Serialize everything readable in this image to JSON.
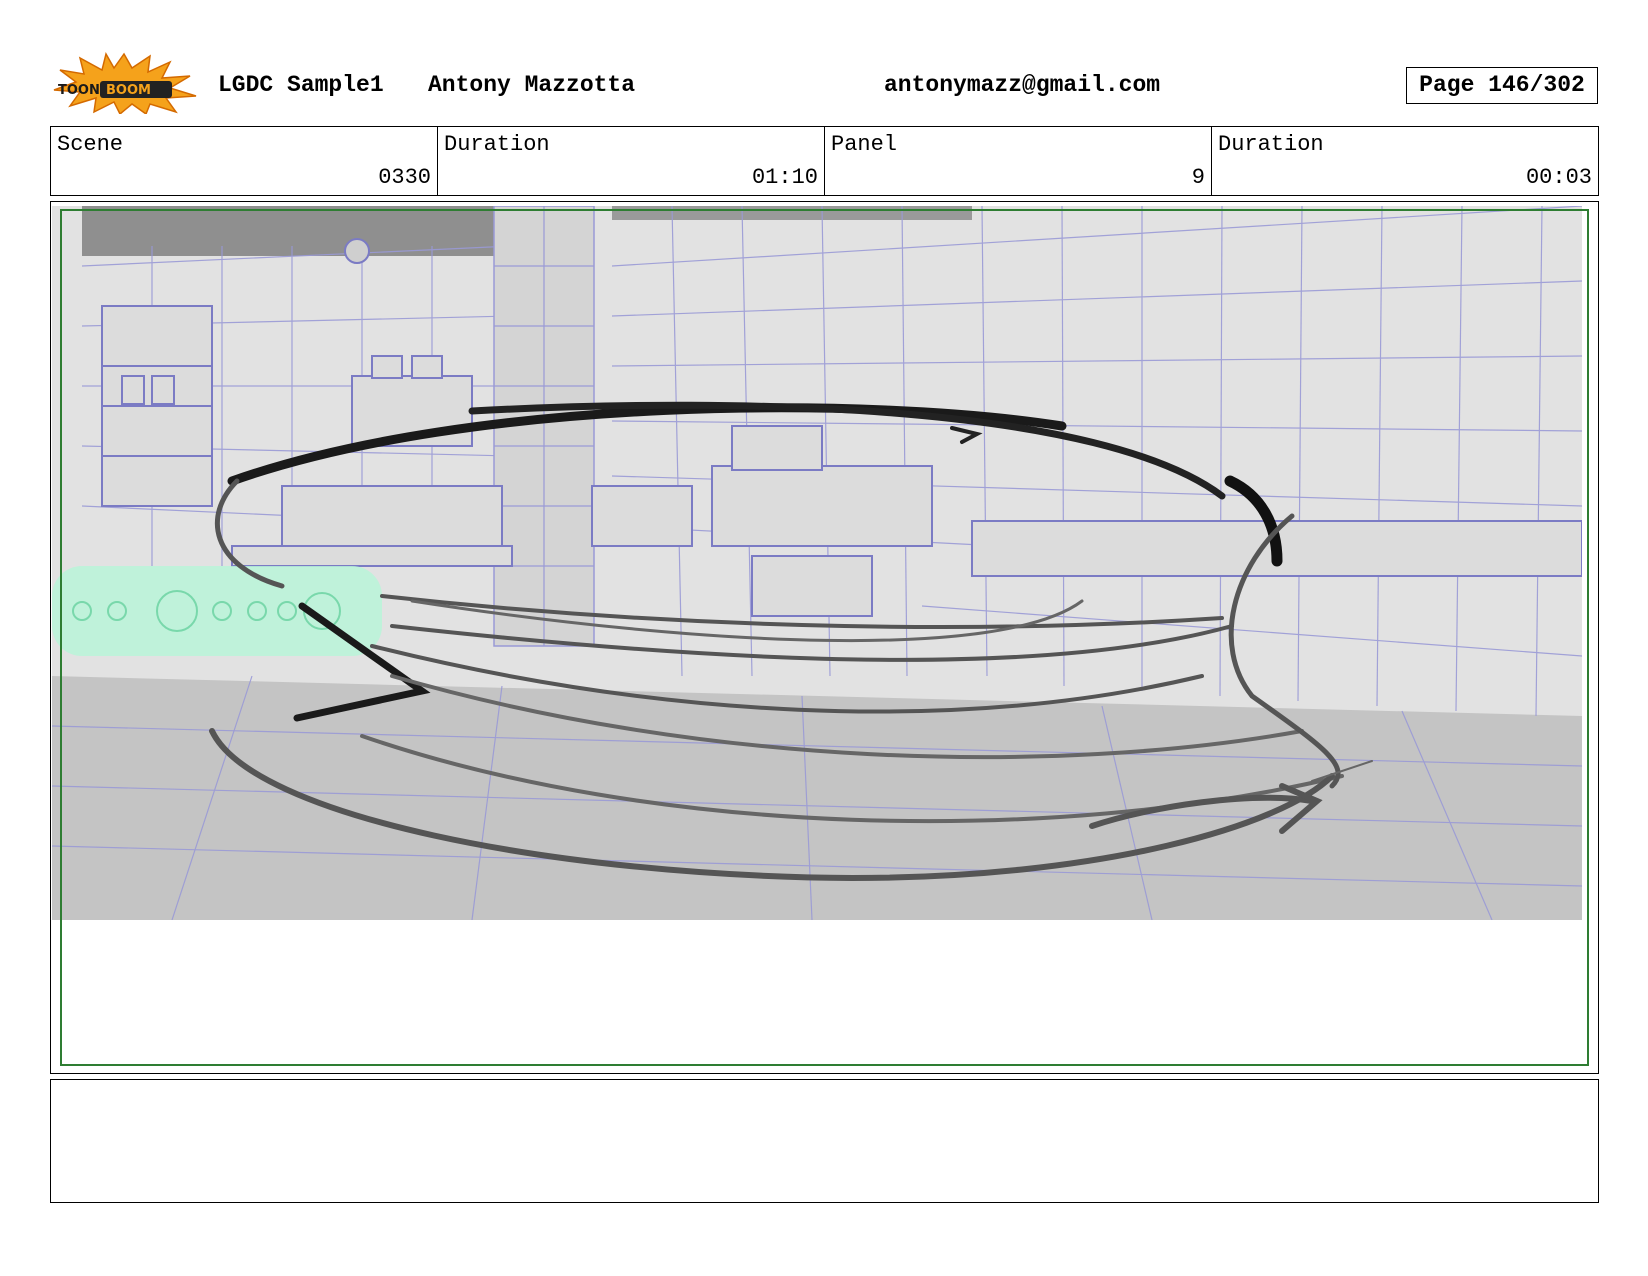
{
  "header": {
    "logo_text": "TOON BOOM",
    "project": "LGDC Sample1",
    "author": "Antony Mazzotta",
    "email": "antonymazz@gmail.com",
    "page": "Page 146/302"
  },
  "info": {
    "scene_label": "Scene",
    "scene_value": "0330",
    "scene_duration_label": "Duration",
    "scene_duration_value": "01:10",
    "panel_label": "Panel",
    "panel_value": "9",
    "panel_duration_label": "Duration",
    "panel_duration_value": "00:03"
  },
  "notes": {
    "text": ""
  },
  "colors": {
    "safe_frame": "#2e7d32",
    "layout_lines": "#9a9ad6",
    "background_gray": "#cfcfcf",
    "highlight_green": "#b9f5d8"
  }
}
